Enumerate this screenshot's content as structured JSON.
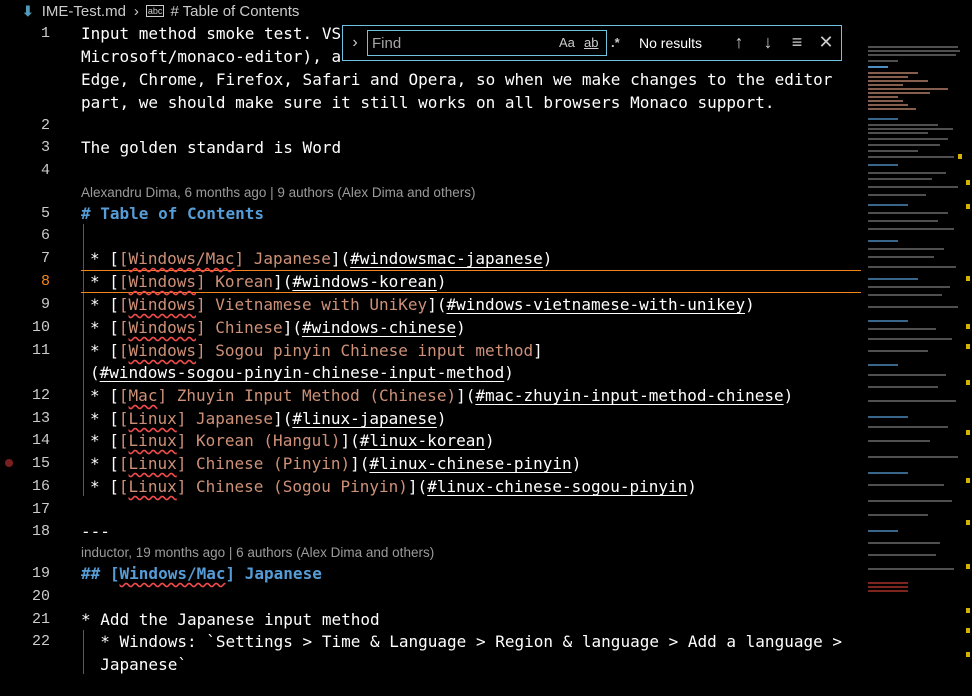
{
  "breadcrumb": {
    "file": "IME-Test.md",
    "symbol": "# Table of Contents",
    "file_icon": "markdown-arrow-icon",
    "symbol_icon": "abc-symbol-icon"
  },
  "find_widget": {
    "placeholder": "Find",
    "value": "",
    "match_case": "Aa",
    "whole_word": "ab",
    "regex": ".*",
    "status": "No results",
    "prev_icon": "arrow-up-icon",
    "next_icon": "arrow-down-icon",
    "selection_icon": "find-in-selection-icon",
    "close_icon": "close-icon"
  },
  "blame": {
    "line5": "Alexandru Dima, 6 months ago | 9 authors (Alex Dima and others)",
    "line19": "inductor, 19 months ago | 6 authors (Alex Dima and others)"
  },
  "line_numbers": [
    "1",
    "2",
    "3",
    "4",
    "5",
    "6",
    "7",
    "8",
    "9",
    "10",
    "11",
    "",
    "12",
    "13",
    "14",
    "15",
    "16",
    "17",
    "18",
    "19",
    "20",
    "21",
    "22",
    ""
  ],
  "content": {
    "l1a": "Input method smoke test. VS",
    "l1b": "Microsoft/monaco-editor), a",
    "l1c": "Edge, Chrome, Firefox, Safari and Opera, so when we make changes to the editor",
    "l1d": "part, we should make sure it still works on all browsers Monaco support.",
    "l3": "The golden standard is Word",
    "l5": "# Table of Contents",
    "toc": [
      {
        "tag": "Windows/Mac",
        "title": " Japanese",
        "ref": "#windowsmac-japanese"
      },
      {
        "tag": "Windows",
        "title": " Korean",
        "ref": "#windows-korean"
      },
      {
        "tag": "Windows",
        "title": " Vietnamese with UniKey",
        "ref": "#windows-vietnamese-with-unikey"
      },
      {
        "tag": "Windows",
        "title": " Chinese",
        "ref": "#windows-chinese"
      },
      {
        "tag": "Windows",
        "title": " Sogou pinyin Chinese input method",
        "ref": "#windows-sogou-pinyin-chinese-input-method"
      },
      {
        "tag": "Mac",
        "title": " Zhuyin Input Method (Chinese)",
        "ref": "#mac-zhuyin-input-method-chinese"
      },
      {
        "tag": "Linux",
        "title": " Japanese",
        "ref": "#linux-japanese"
      },
      {
        "tag": "Linux",
        "title": " Korean (Hangul)",
        "ref": "#linux-korean"
      },
      {
        "tag": "Linux",
        "title": " Chinese (Pinyin)",
        "ref": "#linux-chinese-pinyin"
      },
      {
        "tag": "Linux",
        "title": " Chinese (Sogou Pinyin)",
        "ref": "#linux-chinese-sogou-pinyin"
      }
    ],
    "l18": "---",
    "l19_prefix": "## [",
    "l19_tag": "Windows/Mac",
    "l19_suffix": "] Japanese",
    "l21": "* Add the Japanese input method",
    "l22a": "  * Windows: `Settings > Time & Language > Region & language > Add a language >",
    "l22b": "  Japanese`"
  },
  "colors": {
    "heading": "#569cd6",
    "link_text": "#ce9178",
    "squiggle": "#f14c4c",
    "current_line": "#f38518",
    "focus_border": "#6fc3df",
    "background": "#000000"
  }
}
